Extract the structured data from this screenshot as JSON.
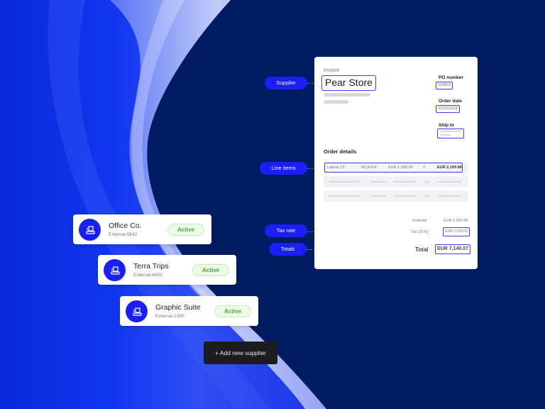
{
  "colors": {
    "background": "#021c63",
    "accent": "#1a1ff5",
    "highlight_border": "#3d3ff0",
    "active_green": "#4aa63b",
    "button_dark": "#1c1c1e"
  },
  "annotations": {
    "supplier": "Supplier",
    "line_items": "Line items",
    "tax_rate": "Tax rate",
    "totals": "Totals"
  },
  "invoice": {
    "label": "Invoice",
    "store_name": "Pear Store",
    "po_number_label": "PO number",
    "po_number": "554852",
    "order_date_label": "Order date",
    "order_date": "01/02/2024",
    "ship_to_label": "Ship to",
    "order_details_label": "Order details",
    "line_item": {
      "name": "Laptop 13'",
      "sku": "MCX014",
      "unit_price": "EUR 1,099.99",
      "qty": "2",
      "total": "EUR 2,199.98"
    },
    "subtotal_label": "Subtotal",
    "subtotal": "EUR 5,900.98",
    "tax_label": "Tax (21%)",
    "tax": "EUR 1,239.09",
    "total_label": "Total",
    "total": "EUR 7,140.07"
  },
  "suppliers": [
    {
      "name": "Office Co.",
      "id": "External-5542",
      "status": "Active",
      "icon": "building-icon"
    },
    {
      "name": "Terra Trips",
      "id": "External-4950",
      "status": "Active",
      "icon": "building-icon"
    },
    {
      "name": "Graphic Suite",
      "id": "External-2390",
      "status": "Active",
      "icon": "building-icon"
    }
  ],
  "add_supplier_button": "+ Add new supplier"
}
